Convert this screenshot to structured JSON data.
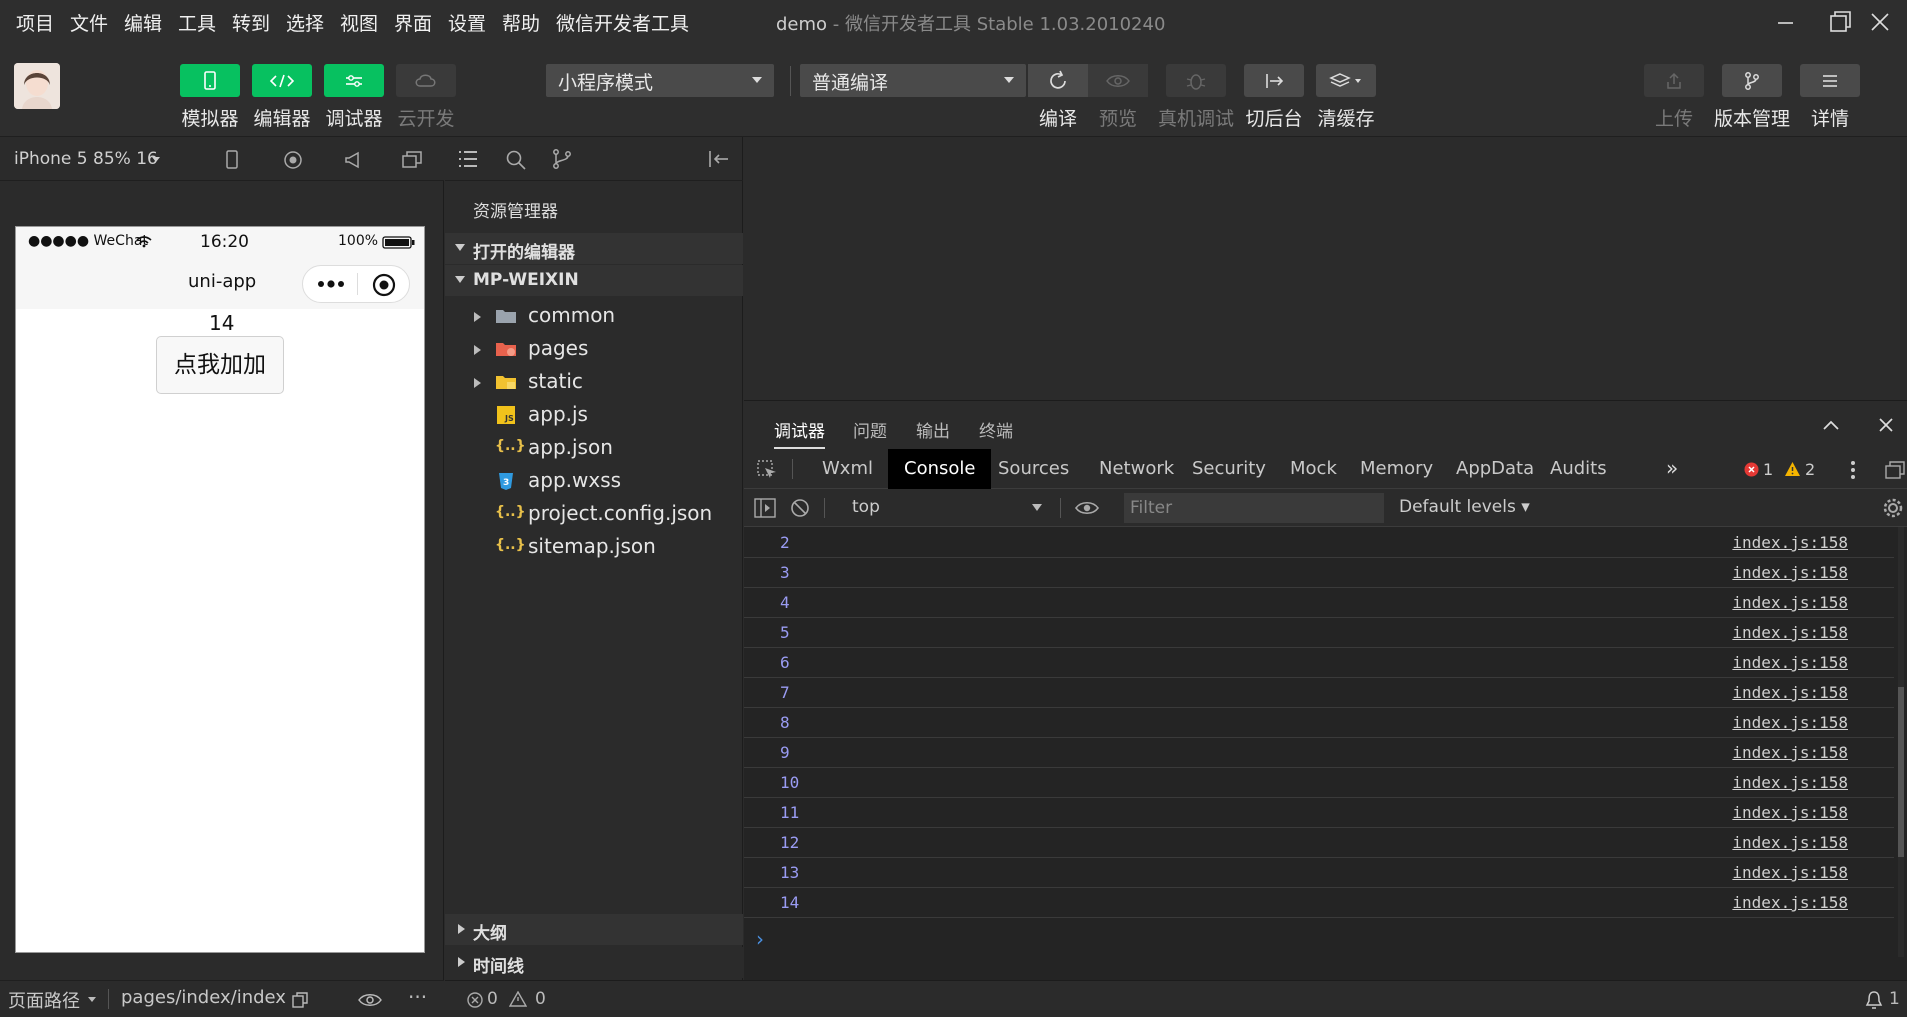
{
  "menubar": {
    "items": [
      "项目",
      "文件",
      "编辑",
      "工具",
      "转到",
      "选择",
      "视图",
      "界面",
      "设置",
      "帮助",
      "微信开发者工具"
    ],
    "title": "demo",
    "title_sub": " - 微信开发者工具 Stable 1.03.2010240"
  },
  "toolbar": {
    "simulator_label": "模拟器",
    "editor_label": "编辑器",
    "debugger_label": "调试器",
    "cloud_label": "云开发",
    "mode_select": "小程序模式",
    "compile_select": "普通编译",
    "compile_label": "编译",
    "preview_label": "预览",
    "remote_debug_label": "真机调试",
    "background_label": "切后台",
    "clear_cache_label": "清缓存",
    "upload_label": "上传",
    "version_label": "版本管理",
    "details_label": "详情"
  },
  "simulator": {
    "device": "iPhone 5 85% 16",
    "status_left": "●●●●● WeChat",
    "status_time": "16:20",
    "status_battery": "100%",
    "nav_title": "uni-app",
    "counter": "14",
    "button_label": "点我加加",
    "page_path_label": "页面路径",
    "page_path": "pages/index/index"
  },
  "explorer": {
    "header": "资源管理器",
    "open_editors": "打开的编辑器",
    "project": "MP-WEIXIN",
    "files": [
      {
        "name": "common",
        "type": "folder"
      },
      {
        "name": "pages",
        "type": "folder-pages"
      },
      {
        "name": "static",
        "type": "folder-static"
      },
      {
        "name": "app.js",
        "type": "js"
      },
      {
        "name": "app.json",
        "type": "json"
      },
      {
        "name": "app.wxss",
        "type": "wxss"
      },
      {
        "name": "project.config.json",
        "type": "json"
      },
      {
        "name": "sitemap.json",
        "type": "json"
      }
    ],
    "outline": "大纲",
    "timeline": "时间线"
  },
  "debug_panel": {
    "tabs": [
      "调试器",
      "问题",
      "输出",
      "终端"
    ],
    "devtools_tabs": [
      "Wxml",
      "Console",
      "Sources",
      "Network",
      "Security",
      "Mock",
      "Memory",
      "AppData",
      "Audits"
    ],
    "active_devtools_tab": "Console",
    "more": "»",
    "error_count": "1",
    "warning_count": "2",
    "context": "top",
    "filter_placeholder": "Filter",
    "levels": "Default levels ▾",
    "logs": [
      {
        "value": "2",
        "source": "index.js:158"
      },
      {
        "value": "3",
        "source": "index.js:158"
      },
      {
        "value": "4",
        "source": "index.js:158"
      },
      {
        "value": "5",
        "source": "index.js:158"
      },
      {
        "value": "6",
        "source": "index.js:158"
      },
      {
        "value": "7",
        "source": "index.js:158"
      },
      {
        "value": "8",
        "source": "index.js:158"
      },
      {
        "value": "9",
        "source": "index.js:158"
      },
      {
        "value": "10",
        "source": "index.js:158"
      },
      {
        "value": "11",
        "source": "index.js:158"
      },
      {
        "value": "12",
        "source": "index.js:158"
      },
      {
        "value": "13",
        "source": "index.js:158"
      },
      {
        "value": "14",
        "source": "index.js:158"
      }
    ],
    "prompt": "›"
  },
  "status_bar": {
    "errors": "0",
    "warnings": "0",
    "notifications": "1"
  },
  "colors": {
    "accent_green": "#07c160",
    "console_value": "#9a9cf3"
  }
}
